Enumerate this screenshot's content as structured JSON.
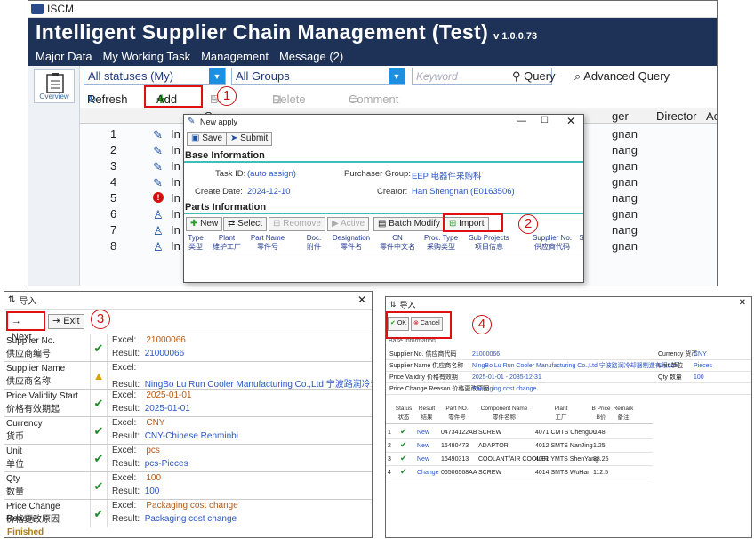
{
  "app": {
    "title": "ISCM",
    "banner": "Intelligent Supplier Chain Management (Test)",
    "version": "v 1.0.0.73"
  },
  "menu": [
    "Major Data",
    "My Working Task",
    "Management",
    "Message (2)"
  ],
  "sidebar": {
    "overview": "Overview"
  },
  "filters": {
    "status": "All statuses (My)",
    "group": "All Groups",
    "keyword_placeholder": "Keyword",
    "query": "Query",
    "advanced": "Advanced Query"
  },
  "toolbar": {
    "refresh": "Refresh",
    "add": "Add",
    "edit": "Edit",
    "delete": "Delete",
    "comment": "Comment"
  },
  "grid": {
    "headers": [
      "S",
      "ger",
      "Director",
      "Accept"
    ],
    "rows": [
      {
        "n": "1",
        "s": "In apply",
        "r": "gnan"
      },
      {
        "n": "2",
        "s": "In apply",
        "r": "nang"
      },
      {
        "n": "3",
        "s": "In apply",
        "r": "gnan"
      },
      {
        "n": "4",
        "s": "In apply",
        "r": "gnan"
      },
      {
        "n": "5",
        "s": "In apply",
        "r": "nang"
      },
      {
        "n": "6",
        "s": "In super",
        "r": "gnan"
      },
      {
        "n": "7",
        "s": "In super",
        "r": "nang"
      },
      {
        "n": "8",
        "s": "In super",
        "r": "gnan"
      }
    ]
  },
  "steps": [
    "1",
    "2",
    "3",
    "4"
  ],
  "new_apply": {
    "title": "New apply",
    "save": "Save",
    "submit": "Submit",
    "base_info": "Base Information",
    "task_id_label": "Task ID:",
    "task_id": "(auto assign)",
    "pgroup_label": "Purchaser Group:",
    "pgroup": "EEP 电器件采购科",
    "cdate_label": "Create Date:",
    "cdate": "2024-12-10",
    "creator_label": "Creator:",
    "creator": "Han Shengnan (E0163506)",
    "parts_info": "Parts Information",
    "buttons": [
      "New",
      "Select",
      "Reomove",
      "Active",
      "Batch Modify",
      "Import"
    ],
    "cols": [
      [
        "Type",
        "类型"
      ],
      [
        "Plant",
        "维护工厂"
      ],
      [
        "Part Name",
        "零件号"
      ],
      [
        "Doc.",
        "附件"
      ],
      [
        "Designation",
        "零件名"
      ],
      [
        "CN",
        "零件中文名"
      ],
      [
        "Proc. Type",
        "采购类型"
      ],
      [
        "Sub Projects",
        "项目信息"
      ],
      [
        "Supplier No.",
        "供应商代码"
      ],
      [
        "S",
        ""
      ]
    ]
  },
  "import_dialog": {
    "title": "导入",
    "next": "Next",
    "exit": "Exit",
    "status": "Finished",
    "rows": [
      {
        "l1": "Supplier No.",
        "l2": "供应商编号",
        "icon": "check",
        "excel_label": "Excel:",
        "excel": "21000066",
        "result_label": "Result:",
        "result": "21000066"
      },
      {
        "l1": "Supplier Name",
        "l2": "供应商名称",
        "icon": "warning",
        "excel_label": "Excel:",
        "excel": "",
        "result_label": "Result:",
        "result": "NingBo Lu Run Cooler Manufacturing Co.,Ltd 宁波路润冷却器..."
      },
      {
        "l1": "Price Validity Start",
        "l2": "价格有效期起",
        "icon": "check",
        "excel_label": "Excel:",
        "excel": "2025-01-01",
        "result_label": "Result:",
        "result": "2025-01-01"
      },
      {
        "l1": "Currency",
        "l2": "货币",
        "icon": "check",
        "excel_label": "Excel:",
        "excel": "CNY",
        "result_label": "Result:",
        "result": "CNY-Chinese Renminbi"
      },
      {
        "l1": "Unit",
        "l2": "单位",
        "icon": "check",
        "excel_label": "Excel:",
        "excel": "pcs",
        "result_label": "Result:",
        "result": "pcs-Pieces"
      },
      {
        "l1": "Qty",
        "l2": "数量",
        "icon": "check",
        "excel_label": "Excel:",
        "excel": "100",
        "result_label": "Result:",
        "result": "100"
      },
      {
        "l1": "Price Change Reason",
        "l2": "价格更改原因",
        "icon": "check",
        "excel_label": "Excel:",
        "excel": "Packaging cost change",
        "result_label": "Result:",
        "result": "Packaging cost change"
      }
    ]
  },
  "confirm_dialog": {
    "title": "导入",
    "ok": "OK",
    "cancel": "Cancel",
    "section": "Base Information",
    "fields": [
      {
        "l": "Supplier No. 供应商代码",
        "v": "21000066",
        "l2": "Currency 货币",
        "v2": "CNY"
      },
      {
        "l": "Supplier Name 供应商名称",
        "v": "NingBo Lu Run Cooler Manufacturing Co.,Ltd 宁波路润冷却器制造有限公司",
        "l2": "Unit 单位",
        "v2": "Pieces"
      },
      {
        "l": "Price Validity 价格有效期",
        "v": "2025-01-01 - 2035-12-31",
        "l2": "Qty 数量",
        "v2": "100"
      },
      {
        "l": "Price Change Reason 价格更改原因",
        "v": "Packaging cost change",
        "l2": "",
        "v2": ""
      }
    ],
    "headers": [
      [
        "Status",
        "状态"
      ],
      [
        "Result",
        "结果"
      ],
      [
        "Part NO.",
        "零件号"
      ],
      [
        "Component Name",
        "零件名称"
      ],
      [
        "Plant",
        "工厂"
      ],
      [
        "B Price",
        "B价"
      ],
      [
        "Remark",
        "备注"
      ]
    ],
    "rows": [
      {
        "n": "1",
        "result": "New",
        "part": "04734122AB",
        "name": "SCREW",
        "plant": "4071 CMTS ChengDu",
        "price": "0.48"
      },
      {
        "n": "2",
        "result": "New",
        "part": "16480473",
        "name": "ADAPTOR",
        "plant": "4012 SMTS NanJing",
        "price": "1.25"
      },
      {
        "n": "3",
        "result": "New",
        "part": "16490313",
        "name": "COOLANT/AIR COOLER",
        "plant": "4081 YMTS ShenYang",
        "price": "88.25"
      },
      {
        "n": "4",
        "result": "Change",
        "part": "06506568AA",
        "name": "SCREW",
        "plant": "4014 SMTS WuHan",
        "price": "112.5"
      }
    ]
  }
}
